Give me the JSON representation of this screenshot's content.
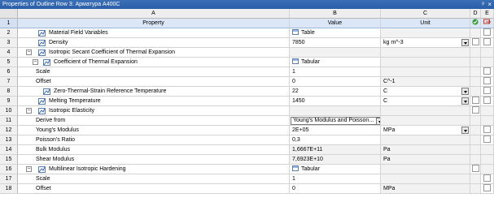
{
  "window": {
    "title": "Properties of Outline Row 3: Арматура А400С",
    "pin": "ᵖ",
    "close": "×"
  },
  "columns": {
    "letters": [
      "A",
      "B",
      "C",
      "D",
      "E"
    ],
    "headers": {
      "property": "Property",
      "value": "Value",
      "unit": "Unit"
    },
    "row_number": "1"
  },
  "rows": [
    {
      "num": "2",
      "property": "Material Field Variables",
      "value": "Table",
      "unit": ""
    },
    {
      "num": "3",
      "property": "Density",
      "value": "7850",
      "unit": "kg m^-3"
    },
    {
      "num": "4",
      "property": "Isotropic Secant Coefficient of Thermal Expansion",
      "value": "",
      "unit": ""
    },
    {
      "num": "5",
      "property": "Coefficient of Thermal Expansion",
      "value": "Tabular",
      "unit": ""
    },
    {
      "num": "6",
      "property": "Scale",
      "value": "1",
      "unit": ""
    },
    {
      "num": "7",
      "property": "Offset",
      "value": "0",
      "unit": "C^-1"
    },
    {
      "num": "8",
      "property": "Zero-Thermal-Strain Reference Temperature",
      "value": "22",
      "unit": "C"
    },
    {
      "num": "9",
      "property": "Melting Temperature",
      "value": "1450",
      "unit": "C"
    },
    {
      "num": "10",
      "property": "Isotropic Elasticity",
      "value": "",
      "unit": ""
    },
    {
      "num": "11",
      "property": "Derive from",
      "value": "Young's Modulus and Poisson...",
      "unit": ""
    },
    {
      "num": "12",
      "property": "Young's Modulus",
      "value": "2E+05",
      "unit": "MPa"
    },
    {
      "num": "13",
      "property": "Poisson's Ratio",
      "value": "0,3",
      "unit": ""
    },
    {
      "num": "14",
      "property": "Bulk Modulus",
      "value": "1,6667E+11",
      "unit": "Pa"
    },
    {
      "num": "15",
      "property": "Shear Modulus",
      "value": "7,6923E+10",
      "unit": "Pa"
    },
    {
      "num": "16",
      "property": "Multilinear Isotropic Hardening",
      "value": "Tabular",
      "unit": ""
    },
    {
      "num": "17",
      "property": "Scale",
      "value": "1",
      "unit": ""
    },
    {
      "num": "18",
      "property": "Offset",
      "value": "0",
      "unit": "MPa"
    }
  ],
  "colors": {
    "title_bar": "#2a5ea8",
    "header_bg": "#dbe7f7",
    "shaded_cell": "#f2f2f2"
  }
}
